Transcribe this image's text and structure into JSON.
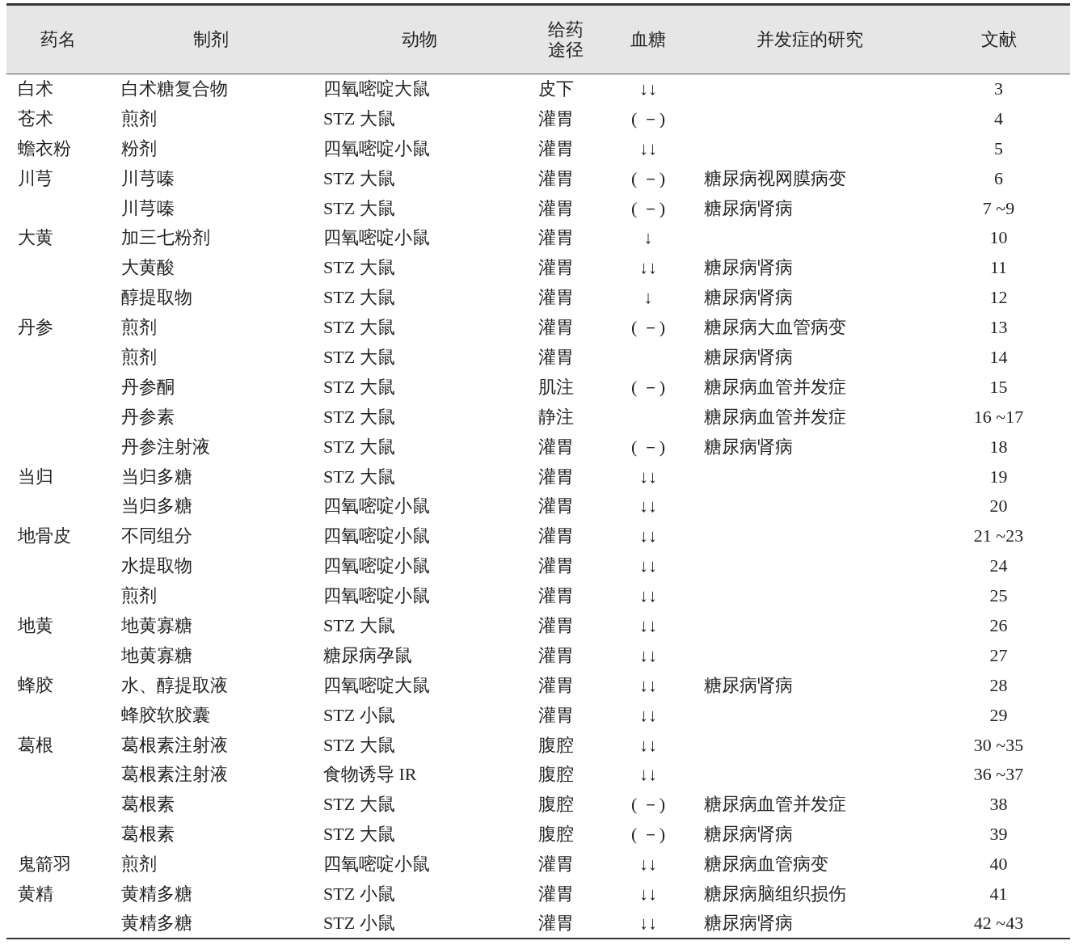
{
  "table": {
    "columns": [
      "药名",
      "制剂",
      "动物",
      "给药途径",
      "血糖",
      "并发症的研究",
      "文献"
    ],
    "rows": [
      {
        "drug": "白术",
        "preparation": "白术糖复合物",
        "animal": "四氧嘧啶大鼠",
        "route": "皮下",
        "glucose": "↓↓",
        "reference": "3"
      },
      {
        "drug": "苍术",
        "preparation": "煎剂",
        "animal": "STZ 大鼠",
        "route": "灌胃",
        "glucose": "( －)",
        "reference": "4"
      },
      {
        "drug": "蟾衣粉",
        "preparation": "粉剂",
        "animal": "四氧嘧啶小鼠",
        "route": "灌胃",
        "glucose": "↓↓",
        "reference": "5"
      },
      {
        "drug": "川芎",
        "preparation": "川芎嗪",
        "animal": "STZ 大鼠",
        "route": "灌胃",
        "glucose": "( －)",
        "complication": "糖尿病视网膜病变",
        "reference": "6"
      },
      {
        "preparation": "川芎嗪",
        "animal": "STZ 大鼠",
        "route": "灌胃",
        "glucose": "( －)",
        "complication": "糖尿病肾病",
        "reference": "7 ~9"
      },
      {
        "drug": "大黄",
        "preparation": "加三七粉剂",
        "animal": "四氧嘧啶小鼠",
        "route": "灌胃",
        "glucose": "↓",
        "reference": "10"
      },
      {
        "preparation": "大黄酸",
        "animal": "STZ 大鼠",
        "route": "灌胃",
        "glucose": "↓↓",
        "complication": "糖尿病肾病",
        "reference": "11"
      },
      {
        "preparation": "醇提取物",
        "animal": "STZ 大鼠",
        "route": "灌胃",
        "glucose": "↓",
        "complication": "糖尿病肾病",
        "reference": "12"
      },
      {
        "drug": "丹参",
        "preparation": "煎剂",
        "animal": "STZ 大鼠",
        "route": "灌胃",
        "glucose": "( －)",
        "complication": "糖尿病大血管病变",
        "reference": "13"
      },
      {
        "preparation": "煎剂",
        "animal": "STZ 大鼠",
        "route": "灌胃",
        "complication": "糖尿病肾病",
        "reference": "14"
      },
      {
        "preparation": "丹参酮",
        "animal": "STZ 大鼠",
        "route": "肌注",
        "glucose": "( －)",
        "complication": "糖尿病血管并发症",
        "reference": "15"
      },
      {
        "preparation": "丹参素",
        "animal": "STZ 大鼠",
        "route": "静注",
        "complication": "糖尿病血管并发症",
        "reference": "16 ~17"
      },
      {
        "preparation": "丹参注射液",
        "animal": "STZ 大鼠",
        "route": "灌胃",
        "glucose": "( －)",
        "complication": "糖尿病肾病",
        "reference": "18"
      },
      {
        "drug": "当归",
        "preparation": "当归多糖",
        "animal": "STZ 大鼠",
        "route": "灌胃",
        "glucose": "↓↓",
        "reference": "19"
      },
      {
        "preparation": "当归多糖",
        "animal": "四氧嘧啶小鼠",
        "route": "灌胃",
        "glucose": "↓↓",
        "reference": "20"
      },
      {
        "drug": "地骨皮",
        "preparation": "不同组分",
        "animal": "四氧嘧啶小鼠",
        "route": "灌胃",
        "glucose": "↓↓",
        "reference": "21 ~23"
      },
      {
        "preparation": "水提取物",
        "animal": "四氧嘧啶小鼠",
        "route": "灌胃",
        "glucose": "↓↓",
        "reference": "24"
      },
      {
        "preparation": "煎剂",
        "animal": "四氧嘧啶小鼠",
        "route": "灌胃",
        "glucose": "↓↓",
        "reference": "25"
      },
      {
        "drug": "地黄",
        "preparation": "地黄寡糖",
        "animal": "STZ 大鼠",
        "route": "灌胃",
        "glucose": "↓↓",
        "reference": "26"
      },
      {
        "preparation": "地黄寡糖",
        "animal": "糖尿病孕鼠",
        "route": "灌胃",
        "glucose": "↓↓",
        "reference": "27"
      },
      {
        "drug": "蜂胶",
        "preparation": "水、醇提取液",
        "animal": "四氧嘧啶大鼠",
        "route": "灌胃",
        "glucose": "↓↓",
        "complication": "糖尿病肾病",
        "reference": "28"
      },
      {
        "preparation": "蜂胶软胶囊",
        "animal": "STZ 小鼠",
        "route": "灌胃",
        "glucose": "↓↓",
        "reference": "29"
      },
      {
        "drug": "葛根",
        "preparation": "葛根素注射液",
        "animal": "STZ 大鼠",
        "route": "腹腔",
        "glucose": "↓↓",
        "reference": "30 ~35"
      },
      {
        "preparation": "葛根素注射液",
        "animal": "食物诱导 IR",
        "route": "腹腔",
        "glucose": "↓↓",
        "reference": "36 ~37"
      },
      {
        "preparation": "葛根素",
        "animal": "STZ 大鼠",
        "route": "腹腔",
        "glucose": "( －)",
        "complication": "糖尿病血管并发症",
        "reference": "38"
      },
      {
        "preparation": "葛根素",
        "animal": "STZ 大鼠",
        "route": "腹腔",
        "glucose": "( －)",
        "complication": "糖尿病肾病",
        "reference": "39"
      },
      {
        "drug": "鬼箭羽",
        "preparation": "煎剂",
        "animal": "四氧嘧啶小鼠",
        "route": "灌胃",
        "glucose": "↓↓",
        "complication": "糖尿病血管病变",
        "reference": "40"
      },
      {
        "drug": "黄精",
        "preparation": "黄精多糖",
        "animal": "STZ 小鼠",
        "route": "灌胃",
        "glucose": "↓↓",
        "complication": "糖尿病脑组织损伤",
        "reference": "41"
      },
      {
        "preparation": "黄精多糖",
        "animal": "STZ 小鼠",
        "route": "灌胃",
        "glucose": "↓↓",
        "complication": "糖尿病肾病",
        "reference": "42 ~43"
      }
    ]
  }
}
